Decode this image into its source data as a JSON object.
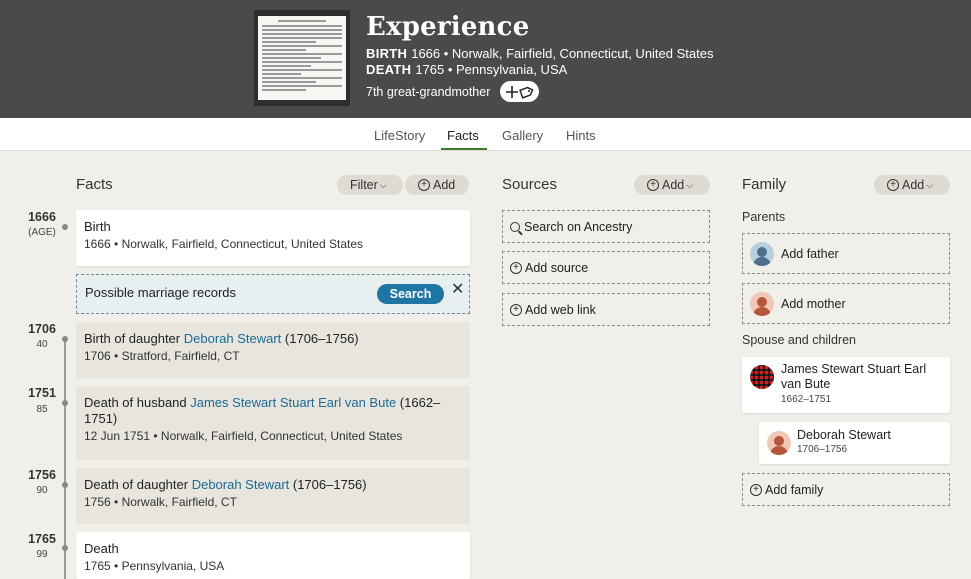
{
  "header": {
    "name": "Experience",
    "birth_label": "BIRTH",
    "birth_value": "1666 • Norwalk, Fairfield, Connecticut, United States",
    "death_label": "DEATH",
    "death_value": "1765 • Pennsylvania, USA",
    "relationship": "7th great-grandmother",
    "tag_button_icon": "plus-tag-icon"
  },
  "tabs": [
    {
      "label": "LifeStory",
      "active": false
    },
    {
      "label": "Facts",
      "active": true
    },
    {
      "label": "Gallery",
      "active": false
    },
    {
      "label": "Hints",
      "active": false
    }
  ],
  "facts": {
    "heading": "Facts",
    "filter_label": "Filter",
    "add_label": "Add",
    "timeline": [
      {
        "year": "1666",
        "age": "(AGE)"
      },
      {
        "year": "1706",
        "age": "40"
      },
      {
        "year": "1751",
        "age": "85"
      },
      {
        "year": "1756",
        "age": "90"
      },
      {
        "year": "1765",
        "age": "99"
      }
    ],
    "birth": {
      "title": "Birth",
      "detail": "1666 • Norwalk, Fairfield, Connecticut, United States"
    },
    "hint": {
      "text": "Possible marriage records",
      "button": "Search",
      "close": "✕"
    },
    "daughter_birth": {
      "prefix": "Birth of daughter ",
      "person": "Deborah Stewart",
      "suffix": " (1706–1756)",
      "detail": "1706 • Stratford, Fairfield, CT"
    },
    "husband_death": {
      "prefix": "Death of husband ",
      "person": "James Stewart Stuart Earl van Bute",
      "suffix": " (1662–1751)",
      "detail": "12 Jun 1751 • Norwalk, Fairfield, Connecticut, United States"
    },
    "daughter_death": {
      "prefix": "Death of daughter ",
      "person": "Deborah Stewart",
      "suffix": " (1706–1756)",
      "detail": "1756 • Norwalk, Fairfield, CT"
    },
    "death": {
      "title": "Death",
      "detail": "1765 • Pennsylvania, USA"
    }
  },
  "sources": {
    "heading": "Sources",
    "add_label": "Add",
    "search_ancestry": "Search on Ancestry",
    "add_source": "Add source",
    "add_web_link": "Add web link"
  },
  "family": {
    "heading": "Family",
    "add_label": "Add",
    "parents_label": "Parents",
    "add_father": "Add father",
    "add_mother": "Add mother",
    "spouse_label": "Spouse and children",
    "spouse": {
      "name": "James Stewart Stuart Earl van Bute",
      "years": "1662–1751"
    },
    "child": {
      "name": "Deborah Stewart",
      "years": "1706–1756"
    },
    "add_family": "Add family"
  },
  "colors": {
    "header_bg": "#4a4a4a",
    "accent_green": "#3d7d2c",
    "link_blue": "#1c6b92",
    "search_button": "#1f76a3"
  }
}
